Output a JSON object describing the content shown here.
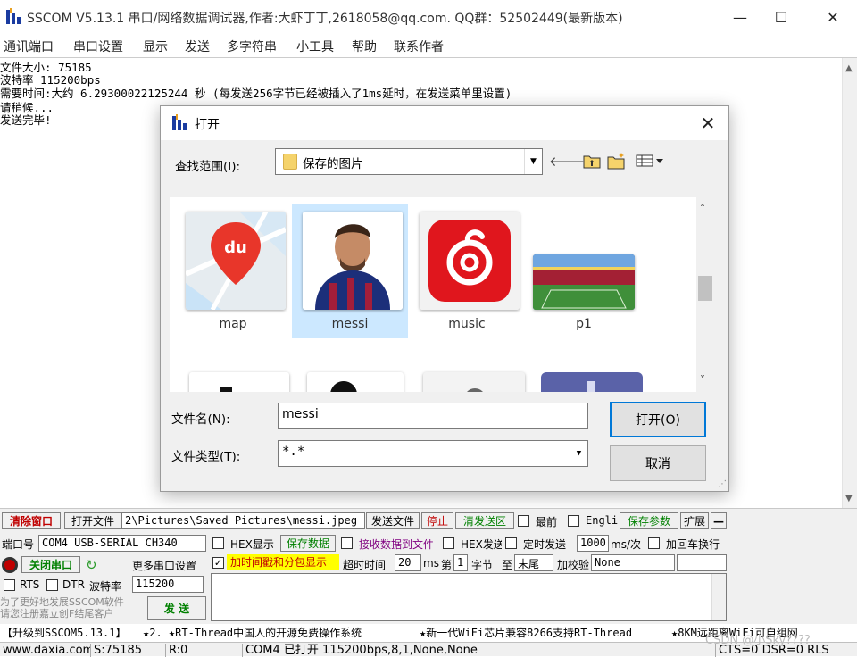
{
  "window": {
    "title": "SSCOM V5.13.1 串口/网络数据调试器,作者:大虾丁丁,2618058@qq.com. QQ群：52502449(最新版本)",
    "minimize": "—",
    "maximize": "☐",
    "close": "✕"
  },
  "menu": [
    "通讯端口",
    "串口设置",
    "显示",
    "发送",
    "多字符串",
    "小工具",
    "帮助",
    "联系作者"
  ],
  "receive": {
    "lines": [
      "文件大小: 75185",
      "波特率 115200bps",
      "需要时间:大约 6.29300022125244 秒 (每发送256字节已经被插入了1ms延时，在发送菜单里设置)",
      "请稍候...",
      "发送完毕!"
    ]
  },
  "dialog": {
    "title": "打开",
    "look_in_label": "查找范围(I):",
    "look_in_value": "保存的图片",
    "files": [
      {
        "name": "map",
        "icon": "baidu-map-icon"
      },
      {
        "name": "messi",
        "icon": "photo-thumbnail"
      },
      {
        "name": "music",
        "icon": "netease-music-icon"
      },
      {
        "name": "p1",
        "icon": "stadium-thumbnail"
      }
    ],
    "filename_label": "文件名(N):",
    "filename_value": "messi",
    "filetype_label": "文件类型(T):",
    "filetype_value": "*.*",
    "open_button": "打开(O)",
    "cancel_button": "取消"
  },
  "panel": {
    "clear_window": "清除窗口",
    "open_file": "打开文件",
    "file_path": "2\\Pictures\\Saved Pictures\\messi.jpeg",
    "send_file": "发送文件",
    "stop": "停止",
    "clear_send": "清发送区",
    "topmost": "最前",
    "english": "Engli",
    "save_params": "保存参数",
    "expand": "扩展",
    "collapse": "—",
    "port_label": "端口号",
    "port_value": "COM4 USB-SERIAL CH340",
    "hex_display": "HEX显示",
    "save_data": "保存数据",
    "recv_to_file": "接收数据到文件",
    "hex_send": "HEX发送",
    "timed_send": "定时发送",
    "interval_value": "1000",
    "interval_unit": "ms/次",
    "add_crlf": "加回车换行",
    "close_port": "关闭串口",
    "more_settings": "更多串口设置",
    "timestamp": "加时间戳和分包显示",
    "timeout_label": "超时时间",
    "timeout_value": "20",
    "timeout_unit": "ms",
    "nth_label": "第",
    "nth_value": "1",
    "byte_label": "字节",
    "to_label": "至",
    "end_value": "末尾",
    "checksum_label": "加校验",
    "checksum_value": "None",
    "rts": "RTS",
    "dtr": "DTR",
    "baud_label": "波特率",
    "baud_value": "115200",
    "promo": "为了更好地发展SSCOM软件\n请您注册嘉立创F结尾客户",
    "send": "发 送",
    "tickers": [
      "【升级到SSCOM5.13.1】",
      "★2. ★RT-Thread中国人的开源免费操作系统",
      "★新一代WiFi芯片兼容8266支持RT-Thread",
      "★8KM远距离WiFi可自组网"
    ]
  },
  "status": {
    "website": "www.daxia.com",
    "sent": "S:75185",
    "received": "R:0",
    "port_state": "COM4 已打开  115200bps,8,1,None,None",
    "lines": "CTS=0 DSR=0 RLS",
    "watermark": "CSDN @小Sky????"
  },
  "colors": {
    "selection": "#cce8ff",
    "accent_red": "#c00000",
    "highlight_yellow": "#ffff00",
    "green_text": "#008000"
  }
}
